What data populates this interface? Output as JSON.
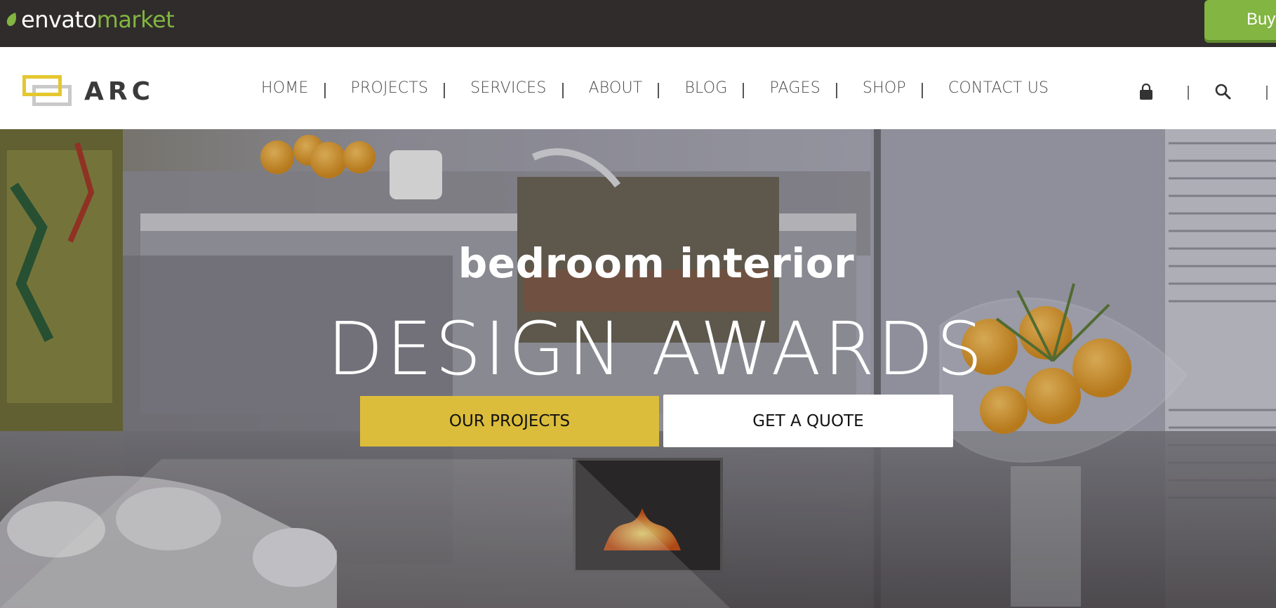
{
  "envato": {
    "logo_word": "envato",
    "logo_market": "market",
    "buy_button": "Buy No"
  },
  "header": {
    "brand": "ARC",
    "nav": [
      "HOME",
      "PROJECTS",
      "SERVICES",
      "ABOUT",
      "BLOG",
      "PAGES",
      "SHOP",
      "CONTACT US"
    ],
    "icons": [
      "shopping-bag-icon",
      "search-icon"
    ]
  },
  "hero": {
    "subtitle": "bedroom interior",
    "title": "DESIGN AWARDS",
    "primary_button": "OUR PROJECTS",
    "secondary_button": "GET A QUOTE"
  },
  "colors": {
    "envato_bar": "#302c2b",
    "envato_green": "#82b541",
    "accent_yellow": "#dbbd3b",
    "brand_gray": "#c9c9c9"
  }
}
